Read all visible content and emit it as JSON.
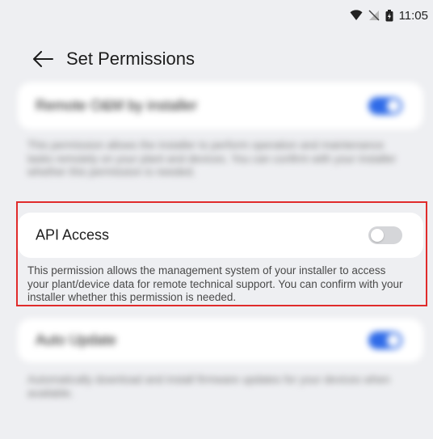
{
  "status_bar": {
    "time": "11:05"
  },
  "header": {
    "title": "Set Permissions"
  },
  "sections": [
    {
      "label": "Remote O&M by installer",
      "enabled": true,
      "description": "This permission allows the installer to perform operation and maintenance tasks remotely on your plant and devices. You can confirm with your installer whether this permission is needed."
    },
    {
      "label": "API Access",
      "enabled": false,
      "description": "This permission allows the management system of your installer to access your plant/device data for remote technical support. You can confirm with your installer whether this permission is needed."
    },
    {
      "label": "Auto Update",
      "enabled": true,
      "description": "Automatically download and install firmware updates for your devices when available."
    }
  ],
  "colors": {
    "accent": "#2f6be8",
    "highlight": "#e02b2b"
  }
}
